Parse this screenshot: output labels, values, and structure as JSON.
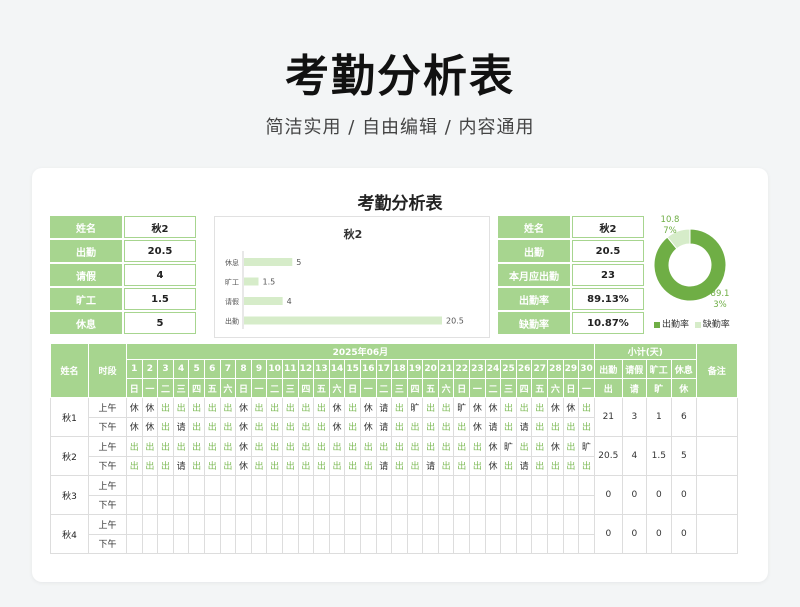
{
  "page": {
    "title": "考勤分析表",
    "subtitle": "简洁实用 / 自由编辑 / 内容通用"
  },
  "sheet": {
    "title": "考勤分析表"
  },
  "colors": {
    "accent": "#a7d58f",
    "accent_dark": "#6fae45",
    "bar": "#d6ecc9"
  },
  "summary_left": [
    {
      "label": "姓名",
      "value": "秋2"
    },
    {
      "label": "出勤",
      "value": "20.5"
    },
    {
      "label": "请假",
      "value": "4"
    },
    {
      "label": "旷工",
      "value": "1.5"
    },
    {
      "label": "休息",
      "value": "5"
    }
  ],
  "summary_right": [
    {
      "label": "姓名",
      "value": "秋2"
    },
    {
      "label": "出勤",
      "value": "20.5"
    },
    {
      "label": "本月应出勤",
      "value": "23"
    },
    {
      "label": "出勤率",
      "value": "89.13%"
    },
    {
      "label": "缺勤率",
      "value": "10.87%"
    }
  ],
  "chart_data": [
    {
      "type": "bar",
      "title": "秋2",
      "categories": [
        "休息",
        "旷工",
        "请假",
        "出勤"
      ],
      "values": [
        5,
        1.5,
        4,
        20.5
      ],
      "data_labels": [
        "5",
        "1.5",
        "4",
        "20.5"
      ]
    },
    {
      "type": "pie",
      "labels": [
        "出勤率",
        "缺勤率"
      ],
      "values": [
        89.13,
        10.87
      ],
      "data_labels": [
        "89.1\n3%",
        "10.8\n7%"
      ],
      "legend": [
        "出勤率",
        "缺勤率"
      ],
      "legend_position": "bottom"
    }
  ],
  "grid": {
    "head_name": "姓名",
    "head_period": "时段",
    "month": "2025年06月",
    "subtotal": "小计(天)",
    "remark": "备注",
    "days": [
      "1",
      "2",
      "3",
      "4",
      "5",
      "6",
      "7",
      "8",
      "9",
      "10",
      "11",
      "12",
      "13",
      "14",
      "15",
      "16",
      "17",
      "18",
      "19",
      "20",
      "21",
      "22",
      "23",
      "24",
      "25",
      "26",
      "27",
      "28",
      "29",
      "30"
    ],
    "weekdays": [
      "日",
      "一",
      "二",
      "三",
      "四",
      "五",
      "六",
      "日",
      "一",
      "二",
      "三",
      "四",
      "五",
      "六",
      "日",
      "一",
      "二",
      "三",
      "四",
      "五",
      "六",
      "日",
      "一",
      "二",
      "三",
      "四",
      "五",
      "六",
      "日",
      "一"
    ],
    "sub_heads_top": [
      "出勤",
      "请假",
      "旷工",
      "休息"
    ],
    "sub_heads_bottom": [
      "出",
      "请",
      "旷",
      "休"
    ],
    "people": [
      {
        "name": "秋1",
        "am_label": "上午",
        "pm_label": "下午",
        "am": [
          "休",
          "休",
          "出",
          "出",
          "出",
          "出",
          "出",
          "休",
          "出",
          "出",
          "出",
          "出",
          "出",
          "休",
          "出",
          "休",
          "请",
          "出",
          "旷",
          "出",
          "出",
          "旷",
          "休",
          "休",
          "出",
          "出",
          "出",
          "休",
          "休",
          "出"
        ],
        "pm": [
          "休",
          "休",
          "出",
          "请",
          "出",
          "出",
          "出",
          "休",
          "出",
          "出",
          "出",
          "出",
          "出",
          "休",
          "出",
          "休",
          "请",
          "出",
          "出",
          "出",
          "出",
          "出",
          "休",
          "请",
          "出",
          "请",
          "出",
          "出",
          "出",
          "出"
        ],
        "totals": [
          "21",
          "3",
          "1",
          "6"
        ]
      },
      {
        "name": "秋2",
        "am_label": "上午",
        "pm_label": "下午",
        "am": [
          "出",
          "出",
          "出",
          "出",
          "出",
          "出",
          "出",
          "休",
          "出",
          "出",
          "出",
          "出",
          "出",
          "出",
          "出",
          "出",
          "出",
          "出",
          "出",
          "出",
          "出",
          "出",
          "出",
          "休",
          "旷",
          "出",
          "出",
          "休",
          "出",
          "旷"
        ],
        "pm": [
          "出",
          "出",
          "出",
          "请",
          "出",
          "出",
          "出",
          "休",
          "出",
          "出",
          "出",
          "出",
          "出",
          "出",
          "出",
          "出",
          "请",
          "出",
          "出",
          "请",
          "出",
          "出",
          "出",
          "休",
          "出",
          "请",
          "出",
          "出",
          "出",
          "出"
        ],
        "totals": [
          "20.5",
          "4",
          "1.5",
          "5"
        ]
      },
      {
        "name": "秋3",
        "am_label": "上午",
        "pm_label": "下午",
        "am": [],
        "pm": [],
        "totals": [
          "0",
          "0",
          "0",
          "0"
        ]
      },
      {
        "name": "秋4",
        "am_label": "上午",
        "pm_label": "下午",
        "am": [],
        "pm": [],
        "totals": [
          "0",
          "0",
          "0",
          "0"
        ]
      }
    ]
  }
}
